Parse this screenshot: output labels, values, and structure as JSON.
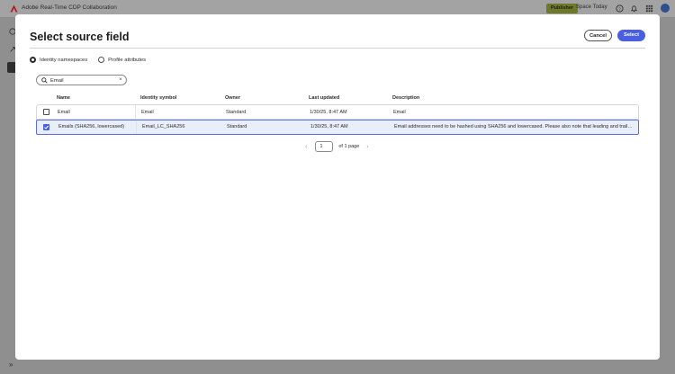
{
  "app": {
    "title": "Adobe Real-Time CDP Collaboration",
    "role_badge": "Publisher",
    "space_name": "Space Today"
  },
  "modal": {
    "title": "Select source field",
    "cancel_label": "Cancel",
    "select_label": "Select",
    "tabs": [
      {
        "label": "Identity namespaces",
        "selected": true
      },
      {
        "label": "Profile attributes",
        "selected": false
      }
    ],
    "search": {
      "value": "Email",
      "placeholder": "Search"
    },
    "columns": [
      "Name",
      "Identity symbol",
      "Owner",
      "Last updated",
      "Description"
    ],
    "rows": [
      {
        "checked": false,
        "name": "Email",
        "symbol": "Email",
        "owner": "Standard",
        "updated": "1/30/25, 8:47 AM",
        "description": "Email"
      },
      {
        "checked": true,
        "name": "Emails (SHA256, lowercased)",
        "symbol": "Email_LC_SHA256",
        "owner": "Standard",
        "updated": "1/30/25, 8:47 AM",
        "description": "Email addresses need to be hashed using SHA256 and lowercased. Please also note that leading and trailing sp..."
      }
    ],
    "pagination": {
      "page": "1",
      "of_label": "of 1 page"
    }
  },
  "colors": {
    "accent": "#4a5fe0",
    "selected_row": "#e9eefb",
    "overlay": "#8f8f8f"
  }
}
